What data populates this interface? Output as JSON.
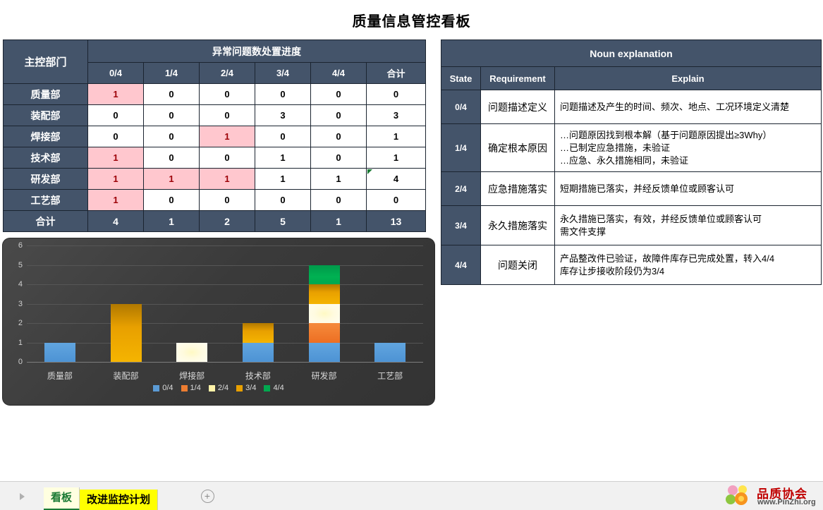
{
  "title": "质量信息管控看板",
  "left_table": {
    "dept_header": "主控部门",
    "group_header": "异常问题数处置进度",
    "columns": [
      "0/4",
      "1/4",
      "2/4",
      "3/4",
      "4/4",
      "合计"
    ],
    "rows": [
      {
        "dept": "质量部",
        "values": [
          "1",
          "0",
          "0",
          "0",
          "0",
          "0"
        ],
        "highlight": [
          true,
          false,
          false,
          false,
          false,
          false
        ]
      },
      {
        "dept": "装配部",
        "values": [
          "0",
          "0",
          "0",
          "3",
          "0",
          "3"
        ],
        "highlight": [
          false,
          false,
          false,
          false,
          false,
          false
        ]
      },
      {
        "dept": "焊接部",
        "values": [
          "0",
          "0",
          "1",
          "0",
          "0",
          "1"
        ],
        "highlight": [
          false,
          false,
          true,
          false,
          false,
          false
        ]
      },
      {
        "dept": "技术部",
        "values": [
          "1",
          "0",
          "0",
          "1",
          "0",
          "1"
        ],
        "highlight": [
          true,
          false,
          false,
          false,
          false,
          false
        ]
      },
      {
        "dept": "研发部",
        "values": [
          "1",
          "1",
          "1",
          "1",
          "1",
          "4"
        ],
        "highlight": [
          true,
          true,
          true,
          false,
          false,
          false
        ],
        "flag_index": 5
      },
      {
        "dept": "工艺部",
        "values": [
          "1",
          "0",
          "0",
          "0",
          "0",
          "0"
        ],
        "highlight": [
          true,
          false,
          false,
          false,
          false,
          false
        ]
      }
    ],
    "total_label": "合计",
    "totals": [
      "4",
      "1",
      "2",
      "5",
      "1",
      "13"
    ]
  },
  "right_table": {
    "title": "Noun explanation",
    "columns": {
      "state": "State",
      "requirement": "Requirement",
      "explain": "Explain"
    },
    "rows": [
      {
        "state": "0/4",
        "requirement": "问题描述定义",
        "explain": "问题描述及产生的时间、频次、地点、工况环境定义清楚"
      },
      {
        "state": "1/4",
        "requirement": "确定根本原因",
        "explain": "…问题原因找到根本解（基于问题原因提出≥3Why）\n…已制定应急措施，未验证\n…应急、永久措施相同，未验证"
      },
      {
        "state": "2/4",
        "requirement": "应急措施落实",
        "explain": "短期措施已落实，并经反馈单位或顾客认可"
      },
      {
        "state": "3/4",
        "requirement": "永久措施落实",
        "explain": "永久措施已落实，有效，并经反馈单位或顾客认可\n需文件支撑"
      },
      {
        "state": "4/4",
        "requirement": "问题关闭",
        "explain": "产品整改件已验证，故障件库存已完成处置，转入4/4\n库存让步接收阶段仍为3/4"
      }
    ]
  },
  "chart_data": {
    "type": "bar",
    "stacked": true,
    "title": "",
    "xlabel": "",
    "ylabel": "",
    "ylim": [
      0,
      6
    ],
    "yticks": [
      "0",
      "1",
      "2",
      "3",
      "4",
      "5",
      "6"
    ],
    "grid": true,
    "legend_position": "bottom",
    "categories": [
      "质量部",
      "装配部",
      "焊接部",
      "技术部",
      "研发部",
      "工艺部"
    ],
    "series": [
      {
        "name": "0/4",
        "color": "#5B9BD5",
        "values": [
          1,
          0,
          0,
          1,
          1,
          1
        ]
      },
      {
        "name": "1/4",
        "color": "#ED7D31",
        "values": [
          0,
          0,
          0,
          0,
          1,
          0
        ]
      },
      {
        "name": "2/4",
        "color": "#FFF2A8",
        "values": [
          0,
          0,
          1,
          0,
          1,
          0
        ]
      },
      {
        "name": "3/4",
        "color": "#E8A000",
        "values": [
          0,
          3,
          0,
          1,
          1,
          0
        ]
      },
      {
        "name": "4/4",
        "color": "#00A84F",
        "values": [
          0,
          0,
          0,
          0,
          1,
          0
        ]
      }
    ]
  },
  "sheet_bar": {
    "tabs": [
      {
        "label": "看板",
        "active": true
      },
      {
        "label": "改进监控计划",
        "active": false
      }
    ],
    "add_sheet": "+"
  },
  "logo": {
    "name": "品质协会",
    "url": "www.PinZhi.org"
  },
  "colors": {
    "header_bg": "#44546A",
    "highlight_bg": "#FFC7CE",
    "highlight_fg": "#9C0006",
    "chart_bg": "#3B3B3B",
    "tab_active": "#1A7A34",
    "tab_plain_bg": "#FFFF00"
  }
}
